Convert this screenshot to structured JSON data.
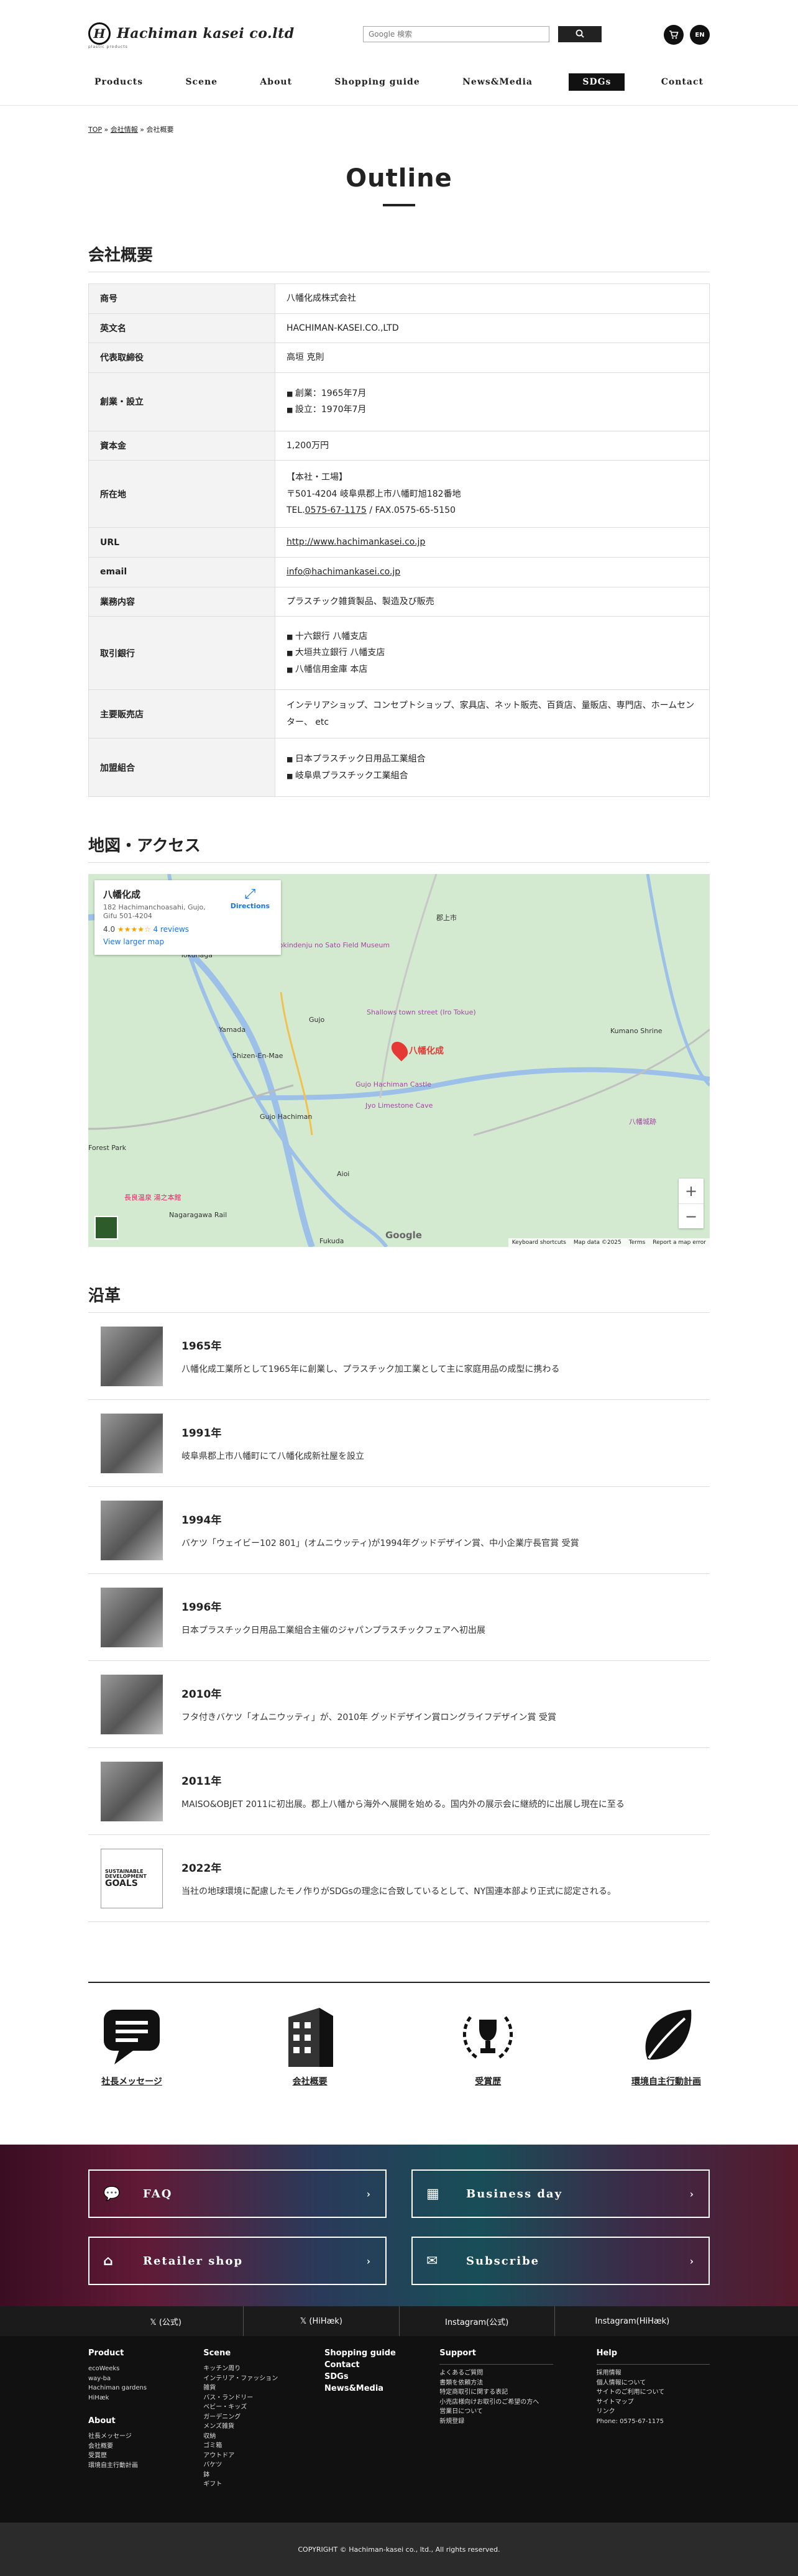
{
  "header": {
    "logo_mark": "H",
    "logo_text": "Hachiman kasei co.ltd",
    "logo_sub": "plastic products",
    "search_placeholder": "Google 検索",
    "cart_icon": "cart-icon",
    "lang_button": "EN",
    "nav": [
      "Products",
      "Scene",
      "About",
      "Shopping guide",
      "News&Media",
      "SDGs",
      "Contact"
    ]
  },
  "breadcrumb": [
    "TOP",
    "会社情報",
    "会社概要"
  ],
  "page_title": "Outline",
  "outline": {
    "heading": "会社概要",
    "rows": [
      {
        "label": "商号",
        "lines": [
          "八幡化成株式会社"
        ]
      },
      {
        "label": "英文名",
        "lines": [
          "HACHIMAN-KASEI.CO.,LTD"
        ]
      },
      {
        "label": "代表取締役",
        "lines": [
          "高垣 克則"
        ]
      },
      {
        "label": "創業・設立",
        "bullets": [
          "創業：1965年7月",
          "設立：1970年7月"
        ]
      },
      {
        "label": "資本金",
        "lines": [
          "1,200万円"
        ]
      },
      {
        "label": "所在地",
        "lines": [
          "【本社・工場】",
          "〒501-4204 岐阜県郡上市八幡町旭182番地"
        ],
        "tel_prefix": "TEL.",
        "tel": "0575-67-1175",
        "fax": " / FAX.0575-65-5150"
      },
      {
        "label": "URL",
        "link": "http://www.hachimankasei.co.jp"
      },
      {
        "label": "email",
        "link": "info@hachimankasei.co.jp"
      },
      {
        "label": "業務内容",
        "lines": [
          "プラスチック雑貨製品、製造及び販売"
        ]
      },
      {
        "label": "取引銀行",
        "bullets": [
          "十六銀行 八幡支店",
          "大垣共立銀行 八幡支店",
          "八幡信用金庫 本店"
        ]
      },
      {
        "label": "主要販売店",
        "lines": [
          "インテリアショップ、コンセプトショップ、家具店、ネット販売、百貨店、量販店、専門店、ホームセンター、 etc"
        ]
      },
      {
        "label": "加盟組合",
        "bullets": [
          "日本プラスチック日用品工業組合",
          "岐阜県プラスチック工業組合"
        ]
      }
    ]
  },
  "map": {
    "heading": "地図・アクセス",
    "place_name": "八幡化成",
    "address": "182 Hachimanchoasahi, Gujo, Gifu 501-4204",
    "rating": "4.0",
    "stars": "★★★★☆",
    "reviews": "4 reviews",
    "larger": "View larger map",
    "directions": "Directions",
    "pin_label": "八幡化成",
    "labels": [
      "Gujo",
      "郡上市",
      "Kokindenju no Sato Field Museum",
      "Tokunaga",
      "Yamada",
      "Shizen-En-Mae",
      "Shallows town street (Iro Tokue)",
      "Gujo Hachiman Castle",
      "Gujo Hachiman",
      "Jyo Limestone Cave",
      "Aioi",
      "Forest Park",
      "Kumano Shrine",
      "Nagaragawa Rail",
      "Fukuda",
      "八幡城跡",
      "長良温泉 湯之本館"
    ],
    "google": "Google",
    "footer": [
      "Keyboard shortcuts",
      "Map data ©2025",
      "Terms",
      "Report a map error"
    ],
    "zoom_in": "+",
    "zoom_out": "−"
  },
  "history": {
    "heading": "沿革",
    "items": [
      {
        "year": "1965年",
        "text": "八幡化成工業所として1965年に創業し、プラスチック加工業として主に家庭用品の成型に携わる"
      },
      {
        "year": "1991年",
        "text": "岐阜県郡上市八幡町にて八幡化成新社屋を設立"
      },
      {
        "year": "1994年",
        "text": "バケツ「ウェイビー102 801」(オムニウッティ)が1994年グッドデザイン賞、中小企業庁長官賞 受賞"
      },
      {
        "year": "1996年",
        "text": "日本プラスチック日用品工業組合主催のジャパンプラスチックフェアへ初出展"
      },
      {
        "year": "2010年",
        "text": "フタ付きバケツ「オムニウッティ」が、2010年 グッドデザイン賞ロングライフデザイン賞 受賞"
      },
      {
        "year": "2011年",
        "text": "MAISO&OBJET 2011に初出展。郡上八幡から海外へ展開を始める。国内外の展示会に継続的に出展し現在に至る"
      },
      {
        "year": "2022年",
        "text": "当社の地球環境に配慮したモノ作りがSDGsの理念に合致しているとして、NY国連本部より正式に認定される。",
        "logo": [
          "SUSTAINABLE",
          "DEVELOPMENT",
          "GOALS"
        ]
      }
    ]
  },
  "links": [
    {
      "label": "社長メッセージ",
      "icon": "message-icon"
    },
    {
      "label": "会社概要",
      "icon": "building-icon"
    },
    {
      "label": "受賞歴",
      "icon": "trophy-icon"
    },
    {
      "label": "環境自主行動計画",
      "icon": "leaf-icon"
    }
  ],
  "banner": [
    {
      "label": "FAQ",
      "icon": "chat-icon"
    },
    {
      "label": "Business day",
      "icon": "calendar-icon"
    },
    {
      "label": "Retailer shop",
      "icon": "shop-icon"
    },
    {
      "label": "Subscribe",
      "icon": "newsletter-icon"
    }
  ],
  "social": [
    "𝕏 (公式)",
    "𝕏 (HiHæk)",
    "Instagram(公式)",
    "Instagram(HiHæk)"
  ],
  "footer": {
    "product": {
      "title": "Product",
      "items": [
        "ecoWeeks",
        "way-ba",
        "Hachiman gardens",
        "HiHæk"
      ]
    },
    "about": {
      "title": "About",
      "items": [
        "社長メッセージ",
        "会社概要",
        "受賞歴",
        "環境自主行動計画"
      ]
    },
    "scene": {
      "title": "Scene",
      "items": [
        "キッチン周り",
        "インテリア・ファッション雑貨",
        "バス・ランドリー",
        "ベビー・キッズ",
        "ガーデニング",
        "メンズ雑貨",
        "収納",
        "ゴミ箱",
        "アウトドア",
        "バケツ",
        "鉢",
        "ギフト"
      ]
    },
    "shopping": [
      "Shopping guide",
      "Contact",
      "SDGs",
      "News&Media"
    ],
    "support": {
      "title": "Support",
      "items": [
        "よくあるご質問",
        "書類を依頼方法",
        "特定商取引に関する表記",
        "小売店様向けお取引のご希望の方へ",
        "営業日について",
        "新規登録"
      ]
    },
    "help": {
      "title": "Help",
      "items": [
        "採用情報",
        "個人情報について",
        "サイトのご利用について",
        "サイトマップ",
        "リンク"
      ],
      "phone": "Phone: 0575-67-1175"
    }
  },
  "copyright": "COPYRIGHT © Hachiman-kasei co., ltd., All rights reserved."
}
